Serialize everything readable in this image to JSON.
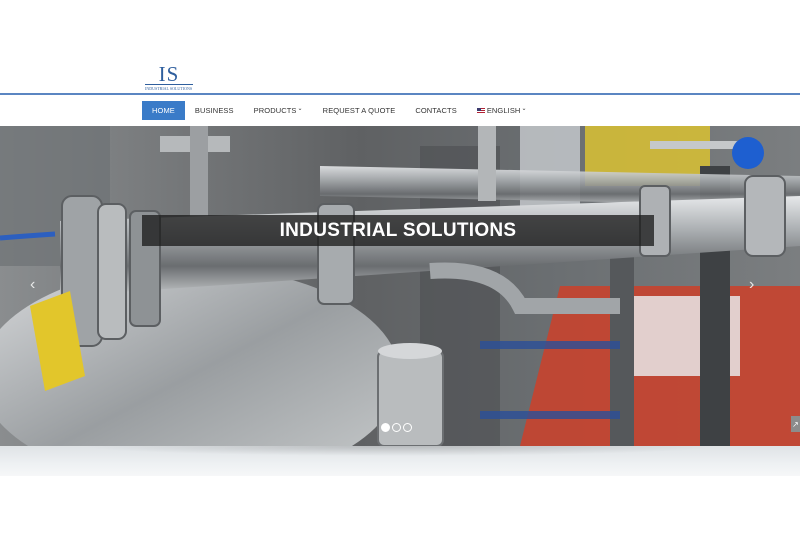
{
  "logo": {
    "letters": "IS",
    "subtitle": "INDUSTRIAL SOLUTIONS"
  },
  "nav": {
    "items": [
      {
        "label": "HOME",
        "active": true
      },
      {
        "label": "BUSINESS"
      },
      {
        "label": "PRODUCTS",
        "dropdown": true
      },
      {
        "label": "REQUEST A QUOTE"
      },
      {
        "label": "CONTACTS"
      },
      {
        "label": "ENGLISH",
        "dropdown": true,
        "icon": "us-flag-icon"
      }
    ]
  },
  "slider": {
    "caption": "INDUSTRIAL SOLUTIONS",
    "prev_icon": "‹",
    "next_icon": "›",
    "slide_count": 3,
    "active_slide": 1
  },
  "colors": {
    "accent": "#3a7bc8",
    "header_line": "#5b86c2",
    "logo": "#2f5f9e"
  }
}
